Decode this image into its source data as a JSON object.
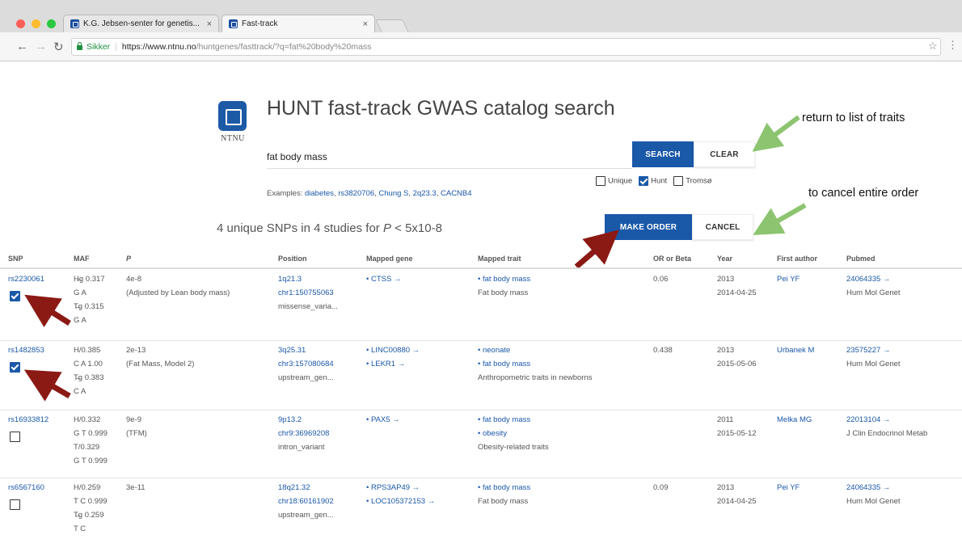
{
  "browser": {
    "tabs": [
      {
        "title": "K.G. Jebsen-senter for genetis...",
        "close": "×"
      },
      {
        "title": "Fast-track",
        "close": "×"
      }
    ],
    "secure_label": "Sikker",
    "url_host": "https://www.ntnu.no",
    "url_path": "/huntgenes/fasttrack/?q=fat%20body%20mass"
  },
  "header": {
    "logo_text": "NTNU",
    "title": "HUNT fast-track GWAS catalog search"
  },
  "search": {
    "value": "fat body mass",
    "search_label": "SEARCH",
    "clear_label": "CLEAR",
    "examples_prefix": "Examples:",
    "examples": [
      "diabetes",
      "rs3820706",
      "Chung S",
      "2q23.3",
      "CACNB4"
    ],
    "filters": [
      {
        "label": "Unique",
        "checked": false
      },
      {
        "label": "Hunt",
        "checked": true
      },
      {
        "label": "Tromsø",
        "checked": false
      }
    ]
  },
  "results": {
    "summary_prefix": "4 unique SNPs in 4 studies for ",
    "summary_p": "P",
    "summary_suffix": " < 5x10-8",
    "make_order_label": "MAKE ORDER",
    "cancel_label": "CANCEL"
  },
  "annotations": {
    "clear": "return to list of traits",
    "cancel": "to cancel entire order"
  },
  "table": {
    "headers": [
      "SNP",
      "MAF",
      "P",
      "Position",
      "Mapped gene",
      "Mapped trait",
      "OR or Beta",
      "Year",
      "First author",
      "Pubmed"
    ],
    "rows": [
      {
        "snp": "rs2230061",
        "checked": true,
        "maf": [
          "H̶g 0.317",
          "G A",
          "T̶g 0.315",
          "G A"
        ],
        "p": [
          "4e-8",
          "(Adjusted by Lean body mass)"
        ],
        "pos": [
          "1q21.3",
          "chr1:150755063",
          "missense_varia..."
        ],
        "genes": [
          "CTSS →"
        ],
        "traits": [
          "fat body mass"
        ],
        "trait_desc": "Fat body mass",
        "or": "0.06",
        "year": [
          "2013",
          "2014-04-25"
        ],
        "author": "Pei YF",
        "pubmed": [
          "24064335 →",
          "Hum Mol Genet"
        ]
      },
      {
        "snp": "rs1482853",
        "checked": true,
        "maf": [
          "H/0.385",
          "C A 1.00",
          "T̶g 0.383",
          "C A"
        ],
        "p": [
          "2e-13",
          "(Fat Mass, Model 2)"
        ],
        "pos": [
          "3q25.31",
          "chr3:157080684",
          "upstream_gen..."
        ],
        "genes": [
          "LINC00880 →",
          "LEKR1 →"
        ],
        "traits": [
          "neonate",
          "fat body mass"
        ],
        "trait_desc": "Anthropometric traits in newborns",
        "or": "0.438",
        "year": [
          "2013",
          "2015-05-06"
        ],
        "author": "Urbanek M",
        "pubmed": [
          "23575227 →",
          "Hum Mol Genet"
        ]
      },
      {
        "snp": "rs16933812",
        "checked": false,
        "maf": [
          "H/0.332",
          "G T 0.999",
          "T/0.329",
          "G T 0.999"
        ],
        "p": [
          "9e-9",
          "(TFM)"
        ],
        "pos": [
          "9p13.2",
          "chr9:36969208",
          "intron_variant"
        ],
        "genes": [
          "PAX5 →"
        ],
        "traits": [
          "fat body mass",
          "obesity"
        ],
        "trait_desc": "Obesity-related traits",
        "or": "",
        "year": [
          "2011",
          "2015-05-12"
        ],
        "author": "Melka MG",
        "pubmed": [
          "22013104 →",
          "J Clin Endocrinol Metab"
        ]
      },
      {
        "snp": "rs6567160",
        "checked": false,
        "maf": [
          "H/0.259",
          "T C 0.999",
          "T̶g 0.259",
          "T C"
        ],
        "p": [
          "3e-11",
          ""
        ],
        "pos": [
          "18q21.32",
          "chr18:60161902",
          "upstream_gen..."
        ],
        "genes": [
          "RPS3AP49 →",
          "LOC105372153 →"
        ],
        "traits": [
          "fat body mass"
        ],
        "trait_desc": "Fat body mass",
        "or": "0.09",
        "year": [
          "2013",
          "2014-04-25"
        ],
        "author": "Pei YF",
        "pubmed": [
          "24064335 →",
          "Hum Mol Genet"
        ]
      }
    ]
  }
}
